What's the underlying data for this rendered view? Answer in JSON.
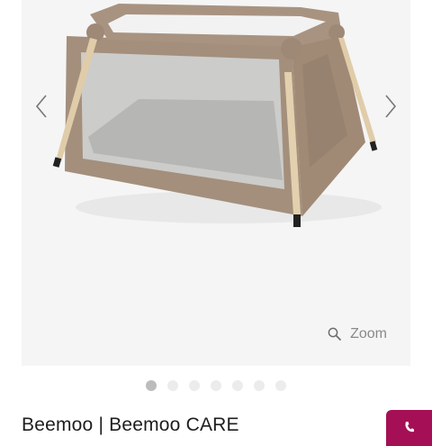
{
  "gallery": {
    "image_alt": "Beemoo CARE travel cot",
    "zoom_label": "Zoom",
    "slide_count": 7,
    "active_slide": 1,
    "prev_icon": "chevron-left-icon",
    "next_icon": "chevron-right-icon",
    "zoom_icon": "magnifier-icon"
  },
  "product": {
    "title": "Beemoo | Beemoo CARE"
  },
  "fab": {
    "icon": "phone-icon",
    "color": "#a50f55"
  },
  "colors": {
    "gallery_bg": "#f5f5f5",
    "dot_active": "#bcbcbc",
    "dot_inactive": "#ececec"
  }
}
